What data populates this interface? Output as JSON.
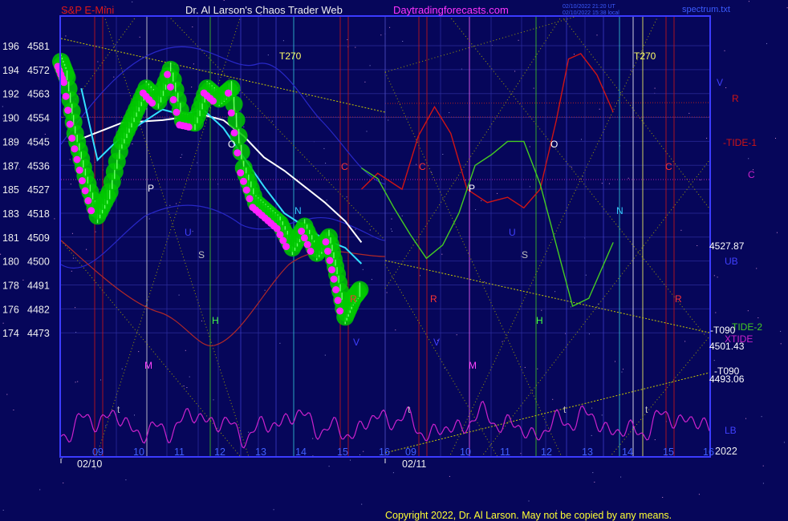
{
  "header": {
    "left_title": "S&P E-Mini",
    "center_title": "Dr. Al Larson's Chaos Trader Web",
    "site": "Daytradingforecasts.com",
    "stamp_line1": "02/10/2022 21:20 UT",
    "stamp_line2": "02/10/2022 15:38 local",
    "right_label": "spectrum.txt"
  },
  "footer": {
    "copyright": "Copyright 2022, Dr. Al Larson. May not be copied by any means."
  },
  "colors": {
    "background": "#06065a",
    "frame": "#3b3bff",
    "price_bars": "#00c800",
    "moving_avg_white": "#ffffff",
    "moving_avg_cyan": "#33e0ff",
    "price_yellow": "#ffff33",
    "dots_magenta": "#ff22ff",
    "tide1_red": "#d01414",
    "tide2_green": "#44cc22",
    "xtide_magenta": "#cc22cc",
    "trend_yellow": "#c8c800"
  },
  "chart_data": {
    "type": "line",
    "title": "S&P E-Mini",
    "y_axis": {
      "left_labels": [
        "196",
        "194",
        "192",
        "190",
        "189",
        "187",
        "185",
        "183",
        "181",
        "180",
        "178",
        "176",
        "174"
      ],
      "price_labels": [
        "4581",
        "4572",
        "4563",
        "4554",
        "4545",
        "4536",
        "4527",
        "4518",
        "4509",
        "4500",
        "4491",
        "4482",
        "4473"
      ],
      "ylim": [
        4473,
        4581
      ]
    },
    "x_axis": {
      "hour_ticks": [
        "09",
        "10",
        "11",
        "12",
        "13",
        "14",
        "15",
        "16",
        "09",
        "10",
        "11",
        "12",
        "13",
        "14",
        "15",
        "16"
      ],
      "dates": [
        "02/10",
        "02/11"
      ],
      "year": "2022"
    },
    "right_labels": {
      "V": "V",
      "R": "R",
      "tide1": "-TIDE-1",
      "C": "C",
      "level_high": "4527.87",
      "UB": "UB",
      "tide2": "TIDE-2",
      "t090_a": "-T090",
      "xtide": "XTIDE",
      "level_mid": "4501.43",
      "t090_b": "-T090",
      "level_low": "4493.06",
      "LB": "LB"
    },
    "vertical_line_labels": [
      {
        "text": "T270",
        "color": "#ffff66"
      },
      {
        "text": "T270",
        "color": "#ffff66"
      },
      {
        "text": "O",
        "color": "#ffffff"
      },
      {
        "text": "O",
        "color": "#ffffff"
      },
      {
        "text": "P",
        "color": "#ffffff"
      },
      {
        "text": "P",
        "color": "#ffffff"
      },
      {
        "text": "U",
        "color": "#4040ff"
      },
      {
        "text": "U",
        "color": "#4040ff"
      },
      {
        "text": "S",
        "color": "#c0c0c0"
      },
      {
        "text": "S",
        "color": "#c0c0c0"
      },
      {
        "text": "N",
        "color": "#33ccff"
      },
      {
        "text": "N",
        "color": "#33ccff"
      },
      {
        "text": "C",
        "color": "#ff3333"
      },
      {
        "text": "C",
        "color": "#ff3333"
      },
      {
        "text": "C",
        "color": "#ff3333"
      },
      {
        "text": "R",
        "color": "#ff3333"
      },
      {
        "text": "R",
        "color": "#ff3333"
      },
      {
        "text": "R",
        "color": "#ff3333"
      },
      {
        "text": "V",
        "color": "#4040ff"
      },
      {
        "text": "V",
        "color": "#4040ff"
      },
      {
        "text": "H",
        "color": "#44ff44"
      },
      {
        "text": "H",
        "color": "#44ff44"
      },
      {
        "text": "M",
        "color": "#ff44ff"
      },
      {
        "text": "M",
        "color": "#ff44ff"
      },
      {
        "text": "t",
        "color": "#c0c0c0"
      },
      {
        "text": "t",
        "color": "#c0c0c0"
      },
      {
        "text": "t",
        "color": "#c0c0c0"
      },
      {
        "text": "t",
        "color": "#c0c0c0"
      }
    ],
    "series": [
      {
        "name": "S&P E-Mini price",
        "x": [
          0,
          0.15,
          0.35,
          0.6,
          0.9,
          1.2,
          1.5,
          1.8,
          2.1,
          2.4,
          2.7,
          3.0,
          3.3,
          3.6,
          3.9,
          4.2,
          4.5,
          4.8,
          5.1,
          5.4,
          5.7,
          6.0,
          6.3,
          6.6,
          6.8,
          7.0,
          7.2,
          7.4
        ],
        "y": [
          4575,
          4569,
          4548,
          4532,
          4517,
          4526,
          4545,
          4555,
          4565,
          4560,
          4572,
          4553,
          4552,
          4565,
          4561,
          4565,
          4535,
          4522,
          4518,
          4514,
          4505,
          4513,
          4503,
          4509,
          4495,
          4479,
          4486,
          4490
        ]
      },
      {
        "name": "moving average (white)",
        "x": [
          0.5,
          1.5,
          2.5,
          3.5,
          4.0,
          4.5,
          5.0,
          5.5,
          6.0,
          6.5,
          7.0,
          7.4
        ],
        "y": [
          4546,
          4552,
          4553,
          4555,
          4553,
          4547,
          4539,
          4534,
          4528,
          4522,
          4515,
          4507
        ]
      },
      {
        "name": "moving average (cyan)",
        "x": [
          0.5,
          0.9,
          1.3,
          1.6,
          2.0,
          2.5,
          3.0,
          3.5,
          4.0,
          4.5,
          5.0,
          5.5,
          6.0,
          6.5,
          7.0,
          7.4
        ],
        "y": [
          4565,
          4538,
          4544,
          4548,
          4552,
          4557,
          4555,
          4557,
          4550,
          4539,
          4528,
          4518,
          4513,
          4508,
          4505,
          4499
        ]
      },
      {
        "name": "TIDE-1",
        "x": [
          7.4,
          7.8,
          8.4,
          8.8,
          9.2,
          9.6,
          10.0,
          10.5,
          11.0,
          11.4,
          11.8,
          12.2,
          12.5,
          12.8,
          13.2,
          13.6
        ],
        "y": [
          4527,
          4533,
          4527,
          4547,
          4558,
          4548,
          4527,
          4522,
          4524,
          4520,
          4527,
          4553,
          4576,
          4578,
          4570,
          4556
        ]
      },
      {
        "name": "TIDE-2",
        "x": [
          7.4,
          7.8,
          8.2,
          8.6,
          9.0,
          9.4,
          9.8,
          10.2,
          10.6,
          11.0,
          11.4,
          11.8,
          12.2,
          12.6,
          13.0,
          13.6
        ],
        "y": [
          4535,
          4531,
          4520,
          4510,
          4501,
          4506,
          4518,
          4536,
          4540,
          4545,
          4545,
          4529,
          4506,
          4483,
          4486,
          4507
        ]
      }
    ]
  }
}
